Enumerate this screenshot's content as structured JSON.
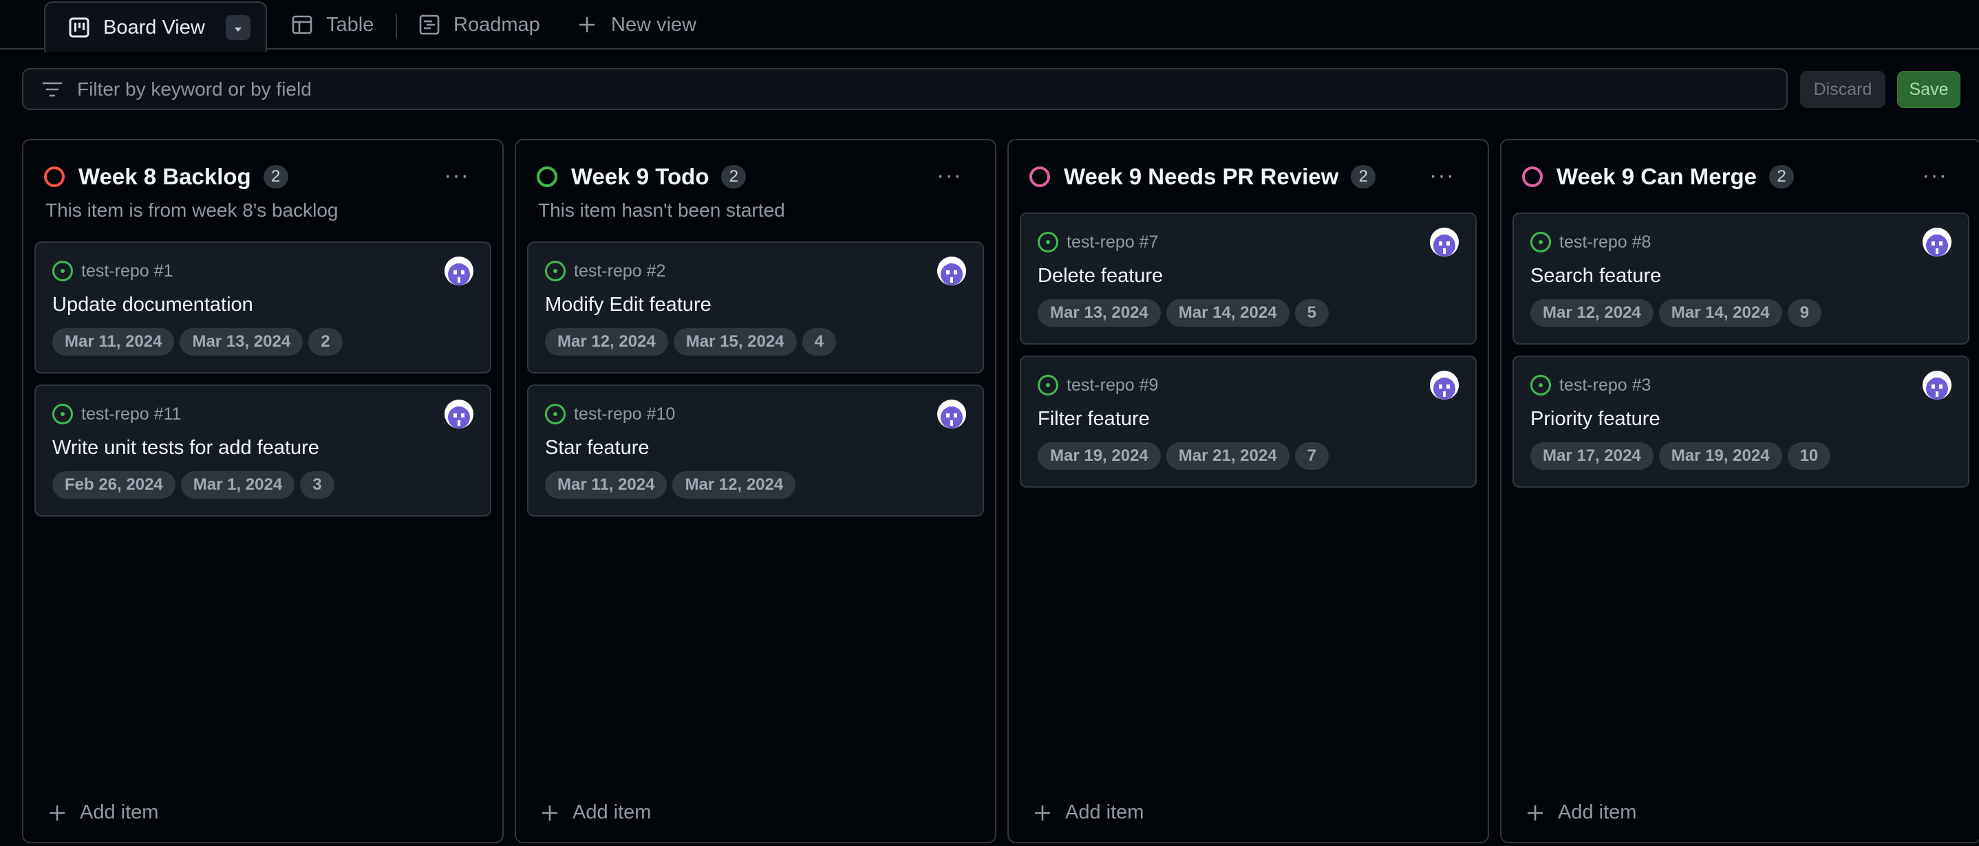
{
  "tabs": {
    "board": "Board View",
    "table": "Table",
    "roadmap": "Roadmap",
    "new_view": "New view"
  },
  "filter": {
    "placeholder": "Filter by keyword or by field"
  },
  "actions": {
    "discard": "Discard",
    "save": "Save"
  },
  "add_item_label": "Add item",
  "columns": [
    {
      "title": "Week 8 Backlog",
      "count": "2",
      "status_color": "#f85149",
      "description": "This item is from week 8's backlog",
      "cards": [
        {
          "ref": "test-repo #1",
          "title": "Update documentation",
          "tags": [
            "Mar 11, 2024",
            "Mar 13, 2024",
            "2"
          ]
        },
        {
          "ref": "test-repo #11",
          "title": "Write unit tests for add feature",
          "tags": [
            "Feb 26, 2024",
            "Mar 1, 2024",
            "3"
          ]
        }
      ]
    },
    {
      "title": "Week 9 Todo",
      "count": "2",
      "status_color": "#3fb950",
      "description": "This item hasn't been started",
      "cards": [
        {
          "ref": "test-repo #2",
          "title": "Modify Edit feature",
          "tags": [
            "Mar 12, 2024",
            "Mar 15, 2024",
            "4"
          ]
        },
        {
          "ref": "test-repo #10",
          "title": "Star feature",
          "tags": [
            "Mar 11, 2024",
            "Mar 12, 2024"
          ]
        }
      ]
    },
    {
      "title": "Week 9 Needs PR Review",
      "count": "2",
      "status_color": "#db61a2",
      "description": "",
      "cards": [
        {
          "ref": "test-repo #7",
          "title": "Delete feature",
          "tags": [
            "Mar 13, 2024",
            "Mar 14, 2024",
            "5"
          ]
        },
        {
          "ref": "test-repo #9",
          "title": "Filter feature",
          "tags": [
            "Mar 19, 2024",
            "Mar 21, 2024",
            "7"
          ]
        }
      ]
    },
    {
      "title": "Week 9 Can Merge",
      "count": "2",
      "status_color": "#db61a2",
      "description": "",
      "cards": [
        {
          "ref": "test-repo #8",
          "title": "Search feature",
          "tags": [
            "Mar 12, 2024",
            "Mar 14, 2024",
            "9"
          ]
        },
        {
          "ref": "test-repo #3",
          "title": "Priority feature",
          "tags": [
            "Mar 17, 2024",
            "Mar 19, 2024",
            "10"
          ]
        }
      ]
    }
  ]
}
